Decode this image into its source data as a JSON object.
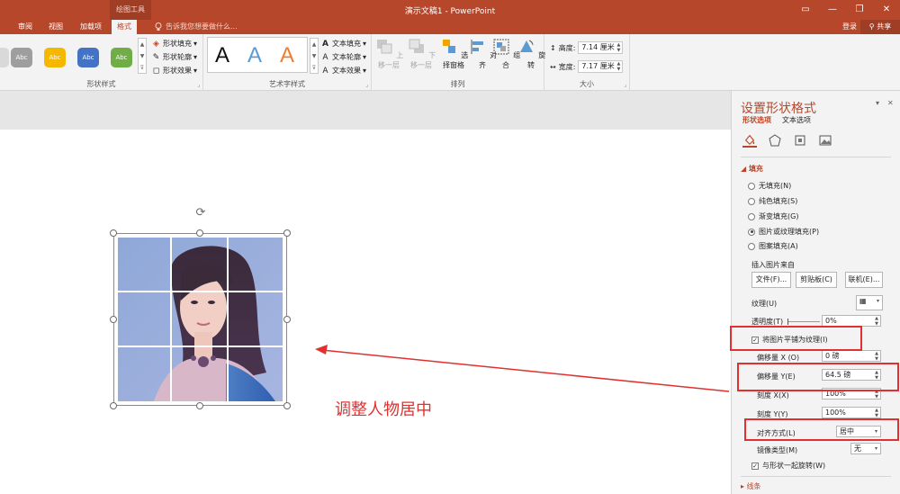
{
  "titlebar": {
    "context_tab": "绘图工具",
    "title": "演示文稿1 - PowerPoint"
  },
  "window_buttons": {
    "ribbon_display": "▭",
    "minimize": "—",
    "restore": "❐",
    "close": "✕"
  },
  "tabs": [
    "审阅",
    "视图",
    "加载项",
    "格式"
  ],
  "active_tab": "格式",
  "tellme": "告诉我您想要做什么...",
  "account": {
    "login": "登录",
    "share": "共享"
  },
  "ribbon": {
    "shape_styles": {
      "label": "形状样式",
      "swatches": [
        {
          "text": "Abc",
          "color": "#9e9e9e"
        },
        {
          "text": "Abc",
          "color": "#f5b800"
        },
        {
          "text": "Abc",
          "color": "#4472c4"
        },
        {
          "text": "Abc",
          "color": "#70ad47"
        }
      ],
      "fill": "形状填充",
      "outline": "形状轮廓",
      "effects": "形状效果"
    },
    "wordart": {
      "label": "艺术字样式",
      "samples": [
        {
          "text": "A",
          "color": "#111111"
        },
        {
          "text": "A",
          "color": "#5b9bd5"
        },
        {
          "text": "A",
          "color": "#ed7d31"
        }
      ],
      "text_fill": "文本填充",
      "text_outline": "文本轮廓",
      "text_effects": "文本效果"
    },
    "arrange": {
      "label": "排列",
      "bring_forward": "上移一层",
      "send_backward": "下移一层",
      "selection_pane": "选择窗格",
      "align": "对齐",
      "group": "组合",
      "rotate": "旋转"
    },
    "size": {
      "label": "大小",
      "height_label": "高度:",
      "height": "7.14 厘米",
      "width_label": "宽度:",
      "width": "7.17 厘米"
    }
  },
  "slide": {
    "annotation": "调整人物居中"
  },
  "pane": {
    "title": "设置形状格式",
    "tabs": [
      "形状选项",
      "文本选项"
    ],
    "fill_section": "填充",
    "fill_options": [
      {
        "label": "无填充(N)",
        "selected": false
      },
      {
        "label": "纯色填充(S)",
        "selected": false
      },
      {
        "label": "渐变填充(G)",
        "selected": false
      },
      {
        "label": "图片或纹理填充(P)",
        "selected": true
      },
      {
        "label": "图案填充(A)",
        "selected": false
      }
    ],
    "insert_from": "插入图片来自",
    "buttons": {
      "file": "文件(F)...",
      "clipboard": "剪贴板(C)",
      "online": "联机(E)..."
    },
    "texture_label": "纹理(U)",
    "transparency_label": "透明度(T)",
    "transparency": "0%",
    "tile_label": "将图片平铺为纹理(I)",
    "tile_checked": true,
    "offset_x_label": "偏移量 X (O)",
    "offset_x": "0 磅",
    "offset_y_label": "偏移量 Y(E)",
    "offset_y": "64.5 磅",
    "scale_x_label": "刻度 X(X)",
    "scale_x": "100%",
    "scale_y_label": "刻度 Y(Y)",
    "scale_y": "100%",
    "alignment_label": "对齐方式(L)",
    "alignment": "居中",
    "mirror_label": "镜像类型(M)",
    "mirror": "无",
    "rotate_with_shape": "与形状一起旋转(W)",
    "line_section": "线条"
  }
}
